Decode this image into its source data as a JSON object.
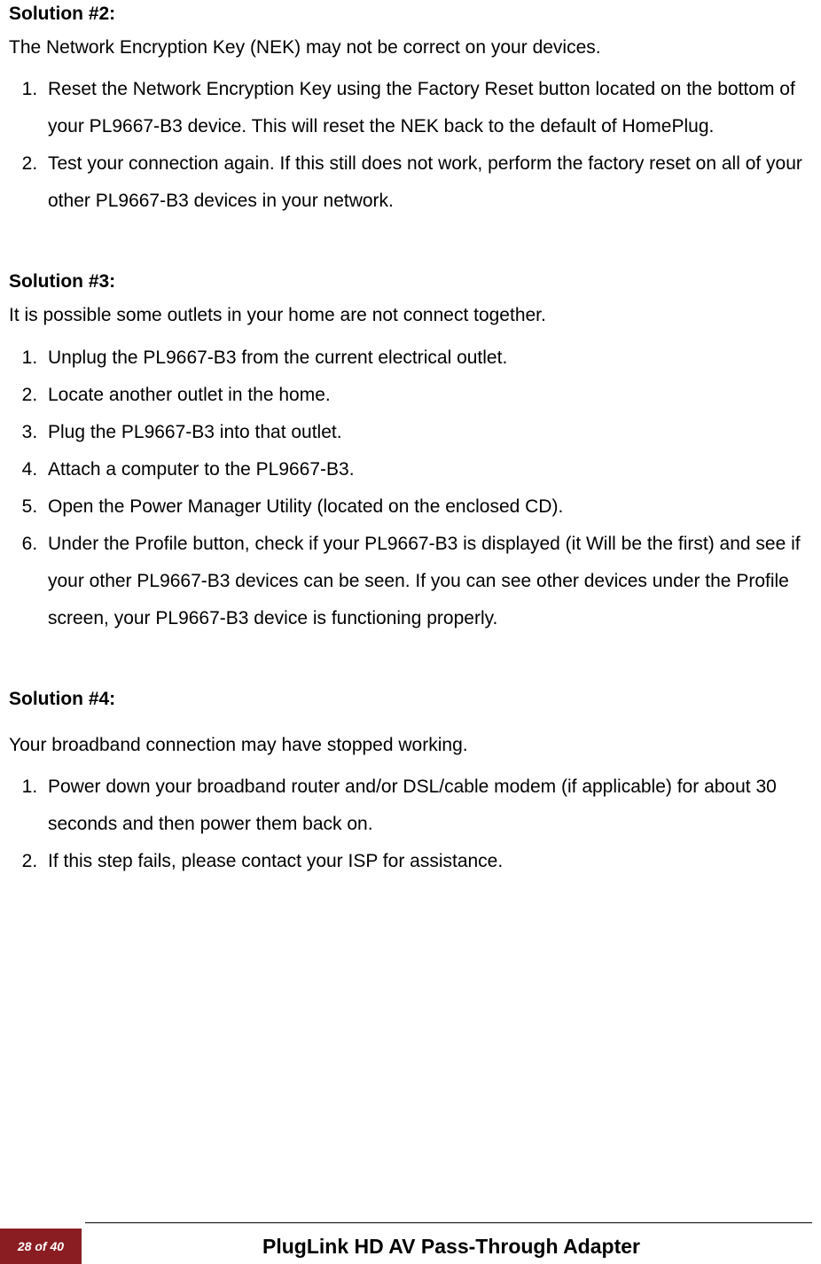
{
  "solution2": {
    "heading": "Solution #2:",
    "intro": "The Network Encryption Key (NEK) may not be correct on your devices.",
    "steps": [
      "Reset the Network Encryption Key using the Factory Reset button located on the bottom of your PL9667-B3 device. This will reset the NEK back to the default of HomePlug.",
      "Test your connection again. If this still does not work, perform the factory reset on all of your other PL9667-B3 devices in your network."
    ]
  },
  "solution3": {
    "heading": "Solution #3:",
    "intro": "It is possible some outlets in your home are not connect together.",
    "steps": [
      "Unplug the PL9667-B3 from the current electrical outlet.",
      "Locate another outlet in the home.",
      "Plug the PL9667-B3 into that outlet.",
      "Attach a computer to the PL9667-B3.",
      "Open the Power Manager Utility (located on the enclosed CD).",
      "Under the Profile button, check if your PL9667-B3 is displayed (it Will be the first) and see if your other PL9667-B3 devices can be seen. If you can see other devices under the Profile screen, your PL9667-B3 device is functioning properly."
    ]
  },
  "solution4": {
    "heading": "Solution #4:",
    "intro": "Your broadband connection may have stopped working.",
    "steps": [
      "Power down your broadband router and/or DSL/cable modem (if applicable) for about 30 seconds and then power them back on.",
      "If this step fails, please contact your ISP for assistance."
    ]
  },
  "footer": {
    "page": "28 of 40",
    "title": "PlugLink HD AV Pass-Through Adapter"
  }
}
